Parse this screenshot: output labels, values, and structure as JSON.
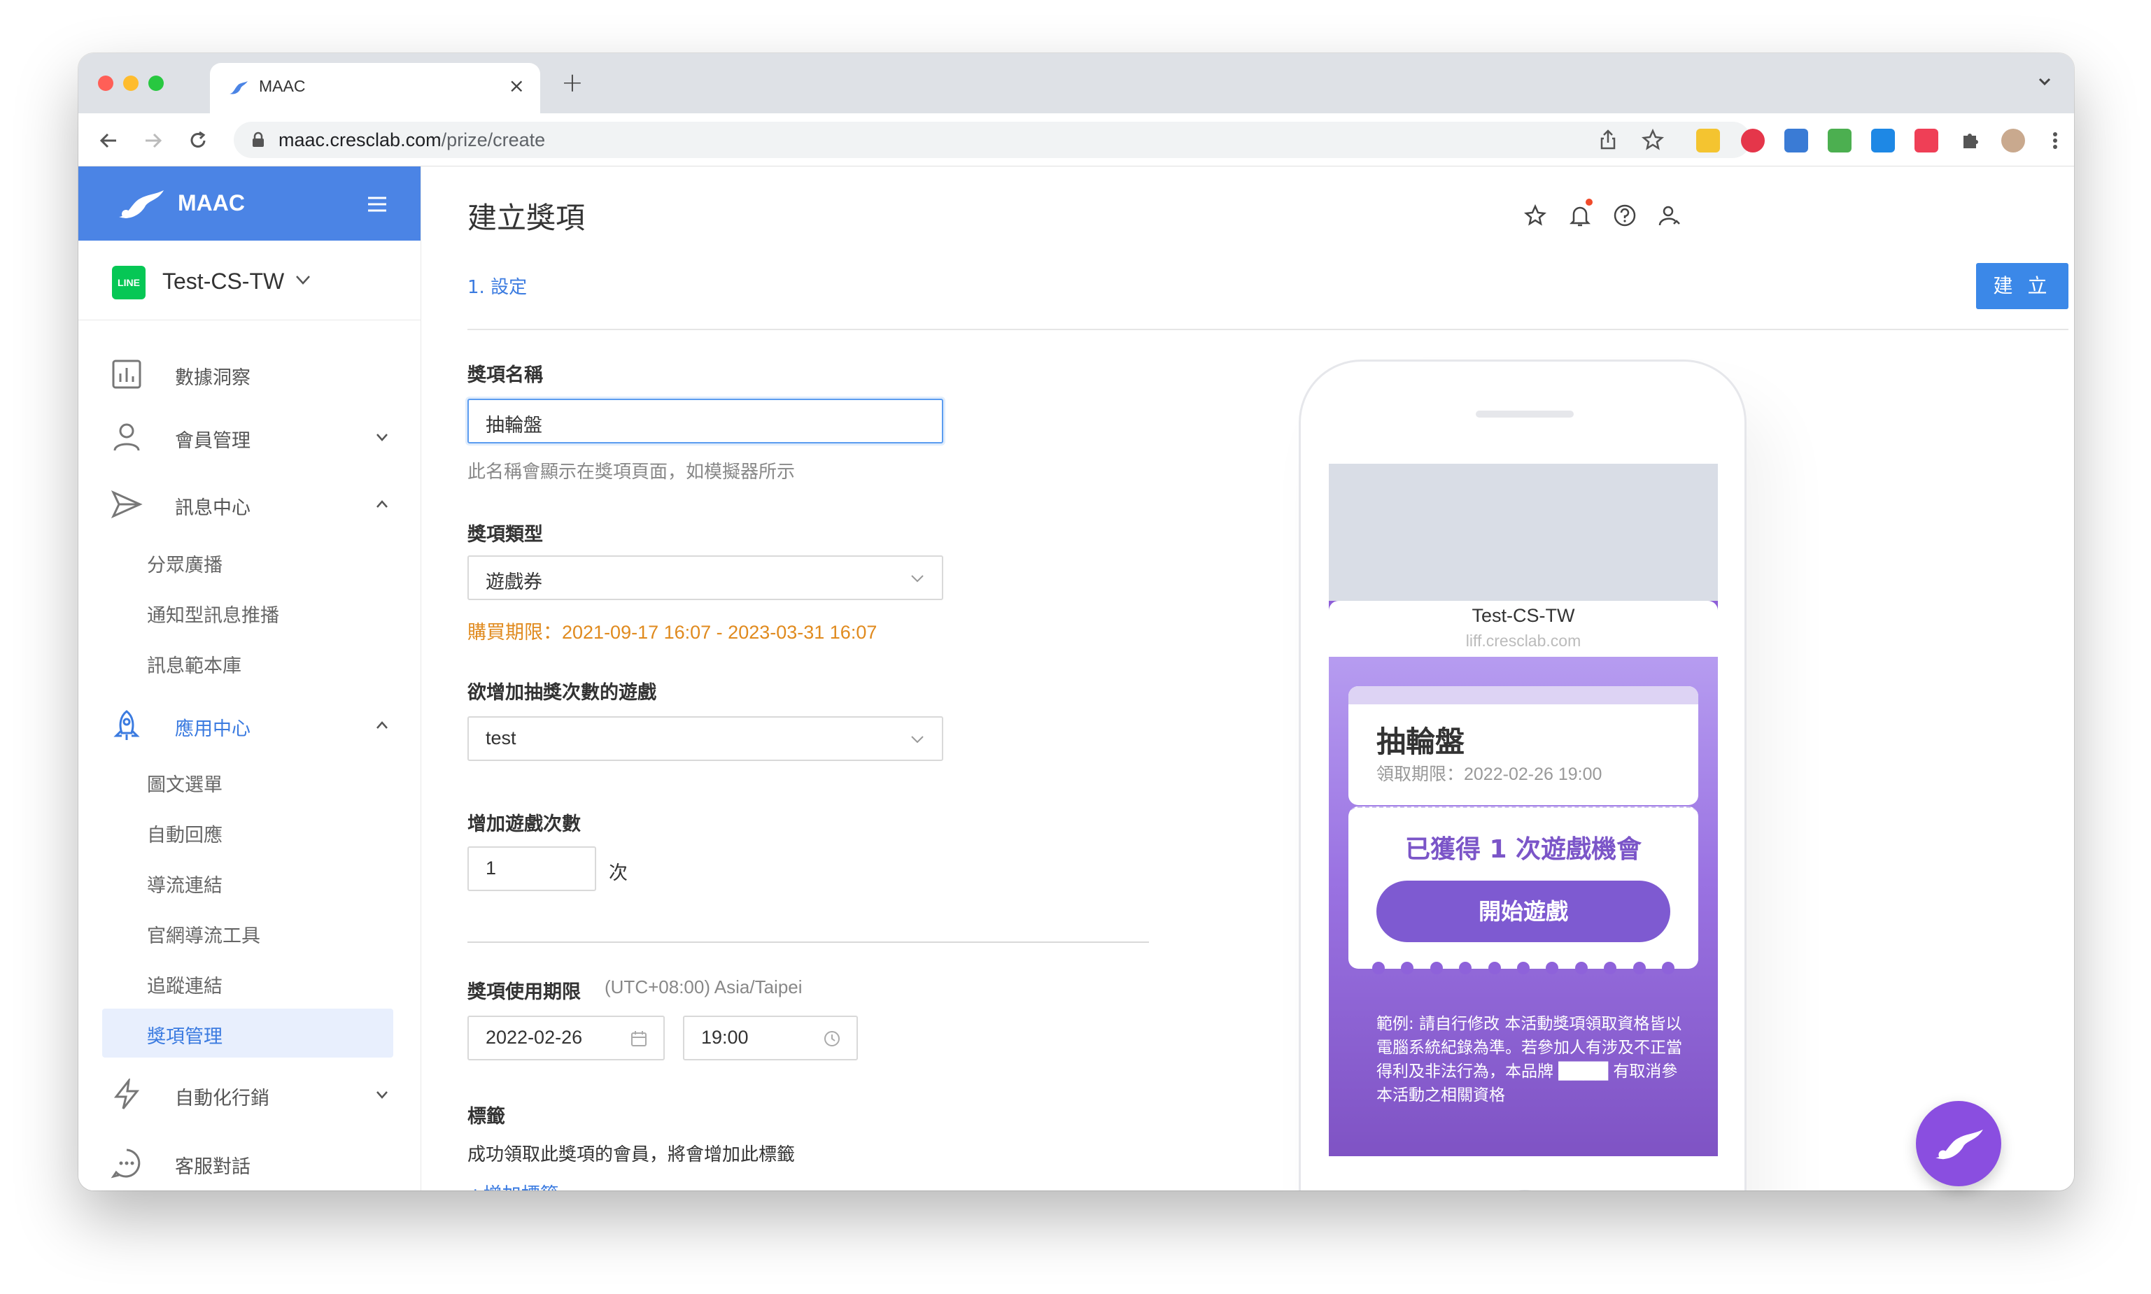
{
  "browser": {
    "tab_title": "MAAC",
    "url_host": "maac.cresclab.com",
    "url_path": "/prize/create"
  },
  "sidebar": {
    "brand": "MAAC",
    "account_badge": "LINE",
    "account_name": "Test-CS-TW",
    "items": [
      {
        "label": "數據洞察",
        "icon": "bar-chart-icon"
      },
      {
        "label": "會員管理",
        "icon": "user-icon"
      },
      {
        "label": "訊息中心",
        "icon": "send-icon"
      },
      {
        "label": "應用中心",
        "icon": "rocket-icon"
      },
      {
        "label": "自動化行銷",
        "icon": "lightning-icon"
      },
      {
        "label": "客服對話",
        "icon": "chat-icon"
      }
    ],
    "message_sub": [
      "分眾廣播",
      "通知型訊息推播",
      "訊息範本庫"
    ],
    "app_sub": [
      "圖文選單",
      "自動回應",
      "導流連結",
      "官網導流工具",
      "追蹤連結",
      "獎項管理"
    ]
  },
  "main": {
    "title": "建立獎項",
    "step": "1. 設定",
    "create_button": "建 立",
    "prize_name_label": "獎項名稱",
    "prize_name_value": "抽輪盤",
    "prize_name_hint": "此名稱會顯示在獎項頁面，如模擬器所示",
    "prize_type_label": "獎項類型",
    "prize_type_value": "遊戲券",
    "purchase_period": "購買期限：2021-09-17 16:07 - 2023-03-31 16:07",
    "game_label": "欲增加抽獎次數的遊戲",
    "game_value": "test",
    "count_label": "增加遊戲次數",
    "count_value": "1",
    "count_unit": "次",
    "expiry_label": "獎項使用期限",
    "timezone": "(UTC+08:00) Asia/Taipei",
    "expiry_date": "2022-02-26",
    "expiry_time": "19:00",
    "tag_label": "標籤",
    "tag_hint": "成功領取此獎項的會員，將會增加此標籤",
    "add_tag": "+增加標籤"
  },
  "preview": {
    "liff_name": "Test-CS-TW",
    "liff_host": "liff.cresclab.com",
    "prize_name": "抽輪盤",
    "deadline": "領取期限：2022-02-26 19:00",
    "message": "已獲得 1 次遊戲機會",
    "play_button": "開始遊戲",
    "terms": "範例: 請自行修改 本活動獎項領取資格皆以電腦系統紀錄為準。若參加人有涉及不正當得利及非法行為，本品牌 ████ 有取消參本活動之相關資格"
  },
  "colors": {
    "brand_blue": "#4b84e5",
    "link_blue": "#3b7be0",
    "warning_orange": "#e08a1e",
    "preview_purple": "#8e5ed8",
    "fab_purple": "#8a4ee0"
  }
}
